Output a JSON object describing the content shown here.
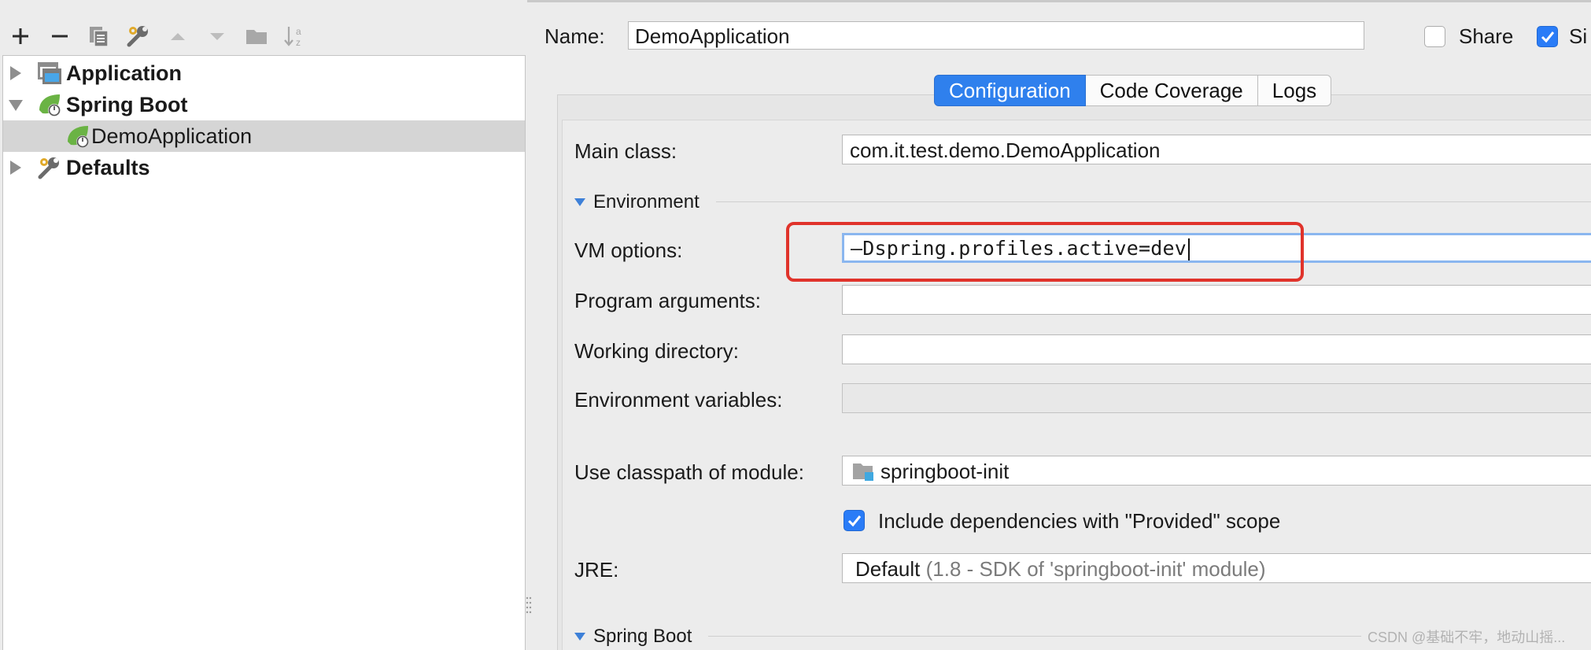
{
  "toolbar": {
    "icons": [
      "plus-icon",
      "minus-icon",
      "copy-icon",
      "wrench-icon",
      "arrow-up-icon",
      "arrow-down-icon",
      "folder-icon",
      "sort-az-icon"
    ]
  },
  "tree": {
    "items": [
      {
        "label": "Application",
        "expanded": false,
        "icon": "application-icon"
      },
      {
        "label": "Spring Boot",
        "expanded": true,
        "icon": "spring-boot-icon"
      },
      {
        "label": "DemoApplication",
        "selected": true,
        "icon": "spring-boot-run-icon"
      },
      {
        "label": "Defaults",
        "expanded": false,
        "icon": "wrench-icon"
      }
    ]
  },
  "header": {
    "name_label": "Name:",
    "name_value": "DemoApplication",
    "share_label": "Share",
    "share_checked": false,
    "single_label": "Si",
    "single_checked": true
  },
  "tabs": [
    {
      "label": "Configuration",
      "active": true
    },
    {
      "label": "Code Coverage",
      "active": false
    },
    {
      "label": "Logs",
      "active": false
    }
  ],
  "form": {
    "main_class_label": "Main class:",
    "main_class_value": "com.it.test.demo.DemoApplication",
    "environment_section": "Environment",
    "vm_options_label": "VM options:",
    "vm_options_value": "–Dspring.profiles.active=dev",
    "program_arguments_label": "Program arguments:",
    "program_arguments_value": "",
    "working_directory_label": "Working directory:",
    "working_directory_value": "",
    "environment_variables_label": "Environment variables:",
    "environment_variables_value": "",
    "classpath_label": "Use classpath of module:",
    "classpath_value": "springboot-init",
    "include_deps_label": "Include dependencies with \"Provided\" scope",
    "include_deps_checked": true,
    "jre_label": "JRE:",
    "jre_value": "Default",
    "jre_detail": "(1.8 - SDK of 'springboot-init' module)",
    "spring_boot_section": "Spring Boot"
  },
  "colors": {
    "accent": "#2f80ed",
    "highlight_box": "#e0332b",
    "spring_green": "#6ab344"
  },
  "watermark": "CSDN @基础不牢，地动山摇..."
}
